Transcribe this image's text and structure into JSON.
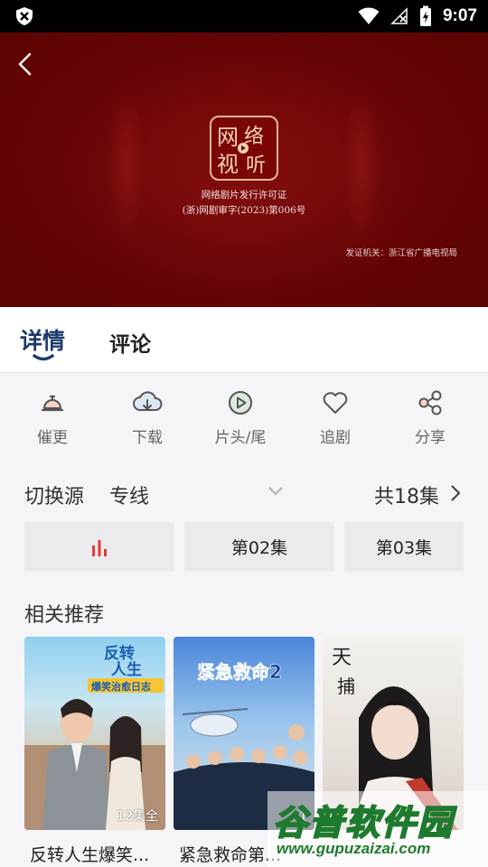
{
  "status_bar": {
    "time": "9:07"
  },
  "video": {
    "seal_text": "网络视听",
    "license_line1": "网络剧片发行许可证",
    "license_line2": "(浙)网剧审字(2023)第006号",
    "issuer": "发证机关：浙江省广播电视局"
  },
  "tabs": [
    {
      "label": "详情"
    },
    {
      "label": "评论"
    }
  ],
  "actions": [
    {
      "label": "催更",
      "icon": "bell-icon"
    },
    {
      "label": "下载",
      "icon": "cloud-download-icon"
    },
    {
      "label": "片头/尾",
      "icon": "play-circle-icon"
    },
    {
      "label": "追剧",
      "icon": "heart-icon"
    },
    {
      "label": "分享",
      "icon": "share-icon"
    }
  ],
  "source": {
    "label": "切换源",
    "value": "专线",
    "episode_count": "共18集"
  },
  "episodes": [
    {
      "label": "",
      "playing": true,
      "icon": "equalizer-icon"
    },
    {
      "label": "第02集"
    },
    {
      "label": "第03集"
    }
  ],
  "related": {
    "title": "相关推荐",
    "items": [
      {
        "name": "反转人生爆笑...",
        "tag": "12集全",
        "poster_title": "反转人生",
        "poster_sub": "爆笑治愈日志"
      },
      {
        "name": "紧急救命第...",
        "tag": "1",
        "poster_title": "紧急救命2"
      },
      {
        "name": "",
        "tag": "",
        "poster_title": "天下第一捕"
      }
    ]
  },
  "watermark": {
    "big": "谷普软件园",
    "small": "www.gupuzaizai.com"
  },
  "colors": {
    "accent": "#1c3b6a",
    "video_bg": "#6a0505",
    "playing": "#e53935"
  }
}
